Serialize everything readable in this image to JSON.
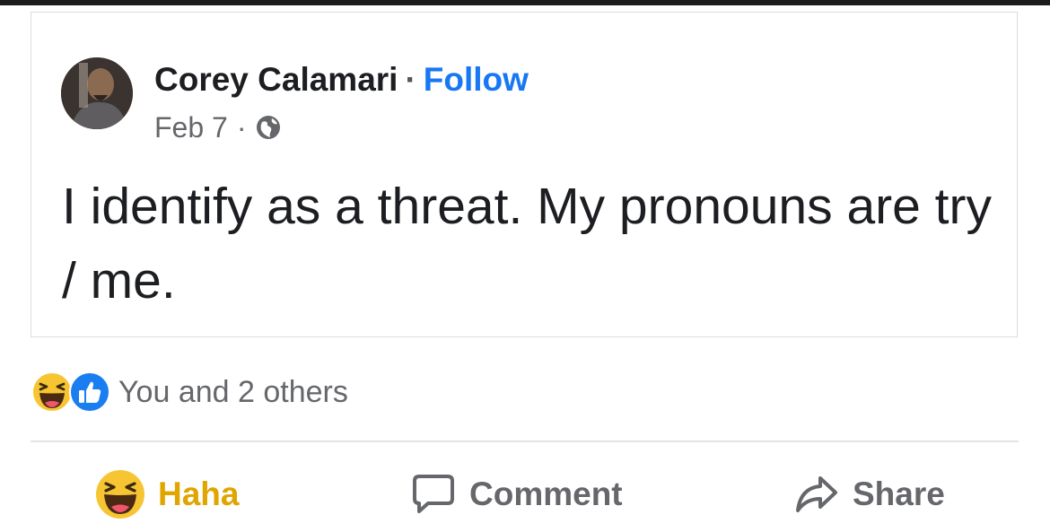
{
  "post": {
    "author": "Corey Calamari",
    "separator": "·",
    "follow_label": "Follow",
    "date": "Feb 7",
    "meta_dot": "·",
    "privacy_icon": "globe-icon",
    "text": "I identify as a threat. My pronouns are try / me."
  },
  "reactions": {
    "icons": [
      "haha-icon",
      "like-icon"
    ],
    "summary": "You and 2 others"
  },
  "actions": {
    "haha_label": "Haha",
    "comment_label": "Comment",
    "share_label": "Share"
  },
  "colors": {
    "follow": "#1877f2",
    "haha_active": "#e0a500",
    "secondary_text": "#65676b"
  }
}
